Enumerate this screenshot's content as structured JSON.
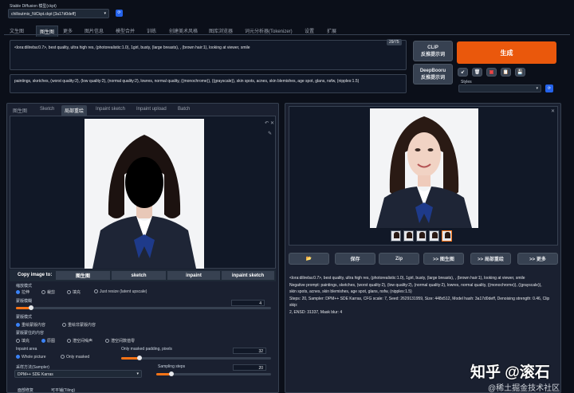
{
  "header": {
    "checkpoint_label": "Stable Diffusion 模型(ckpt)",
    "checkpoint_value": "chilloutmix_NiCkpt.ckpt [3a17d0deff]"
  },
  "tabs": [
    "文生图",
    "图生图",
    "更多",
    "图片信息",
    "模型合并",
    "训练",
    "创建美术风格",
    "图库浏览器",
    "词元分析器(Tokenizer)",
    "设置",
    "扩展"
  ],
  "active_tab": "图生图",
  "prompt": {
    "positive": "<lora:dilireba:0.7>,    best quality, ultra high res, (photorealistic:1.0), 1girl,   busty, (large breasts), , (brown hair:1), looking at viewer, smile",
    "negative": "paintings, sketches, (worst quality:2), (low quality:2), (normal quality:2), lowres, normal quality, ((monochrome)), ((grayscale)), skin spots, acnes, skin blemishes, age spot, glans, nsfw, (nipples:1.5)",
    "token_count": "29/75"
  },
  "interrogate": {
    "clip": "CLIP\n反推提示词",
    "clip_line1": "CLIP",
    "clip_line2": "反推提示词",
    "deepbooru_line1": "DeepBooru",
    "deepbooru_line2": "反推提示词"
  },
  "generate_label": "生成",
  "styles_label": "Styles",
  "img_tabs": [
    "图生图",
    "Sketch",
    "局部重绘",
    "Inpaint sketch",
    "Inpaint upload",
    "Batch"
  ],
  "active_img_tab": "局部重绘",
  "copy_image": {
    "label": "Copy image to:",
    "targets": [
      "图生图",
      "sketch",
      "inpaint",
      "inpaint sketch"
    ]
  },
  "resize_mode": {
    "label": "缩放模式",
    "options": [
      "拉伸",
      "裁剪",
      "填充",
      "Just resize (latent upscale)"
    ],
    "selected": 0
  },
  "mask_blur": {
    "label": "蒙版模糊",
    "value": "4",
    "fraction": 0.06
  },
  "mask_mode": {
    "label": "蒙版模式",
    "options": [
      "重绘蒙版内容",
      "重绘非蒙版内容"
    ],
    "selected": 0
  },
  "masked_content": {
    "label": "蒙版蒙住的内容",
    "options": [
      "填充",
      "原图",
      "潜空间噪声",
      "潜空间数值零"
    ],
    "selected": 1
  },
  "inpaint_area": {
    "label": "Inpaint area",
    "options": [
      "Whole picture",
      "Only masked"
    ],
    "selected": 0
  },
  "padding": {
    "label": "Only masked padding, pixels",
    "value": "32",
    "fraction": 0.12
  },
  "sampler": {
    "label": "采样方法(Sampler)",
    "value": "DPM++ SDE Karras"
  },
  "steps": {
    "label": "Sampling steps",
    "value": "20",
    "fraction": 0.13
  },
  "bottom_labels": [
    "面部修复",
    "可平铺(Tiling)"
  ],
  "output_buttons": [
    "📂",
    "保存",
    "Zip",
    ">> 图生图",
    ">> 局部重绘",
    ">> 更多"
  ],
  "output_info": {
    "line1": "<lora:dilireba:0.7>,    best quality, ultra high res, (photorealistic:1.0), 1girl,   busty, (large breasts), , (brown hair:1), looking at viewer, smile",
    "line2": "Negative prompt: paintings, sketches, (worst quality:2), (low quality:2), (normal quality:2), lowres, normal quality, ((monochrome)), ((grayscale)),",
    "line3": "skin spots, acnes, skin blemishes, age spot, glans, nsfw, (nipples:1.5)",
    "line4": "Steps: 20, Sampler: DPM++ SDE Karras, CFG scale: 7, Seed: 2629131959, Size: 448x512, Model hash: 3a17d0deff, Denoising strength: 0.46, Clip skip:",
    "line5": "2, ENSD: 31337, Mask blur: 4"
  },
  "watermark": {
    "main": "知乎 @滚石",
    "sub": "@稀土掘金技术社区"
  },
  "colors": {
    "accent": "#f97316",
    "background": "#0b0f19",
    "panel": "#1f2937",
    "blue": "#3b82f6"
  }
}
